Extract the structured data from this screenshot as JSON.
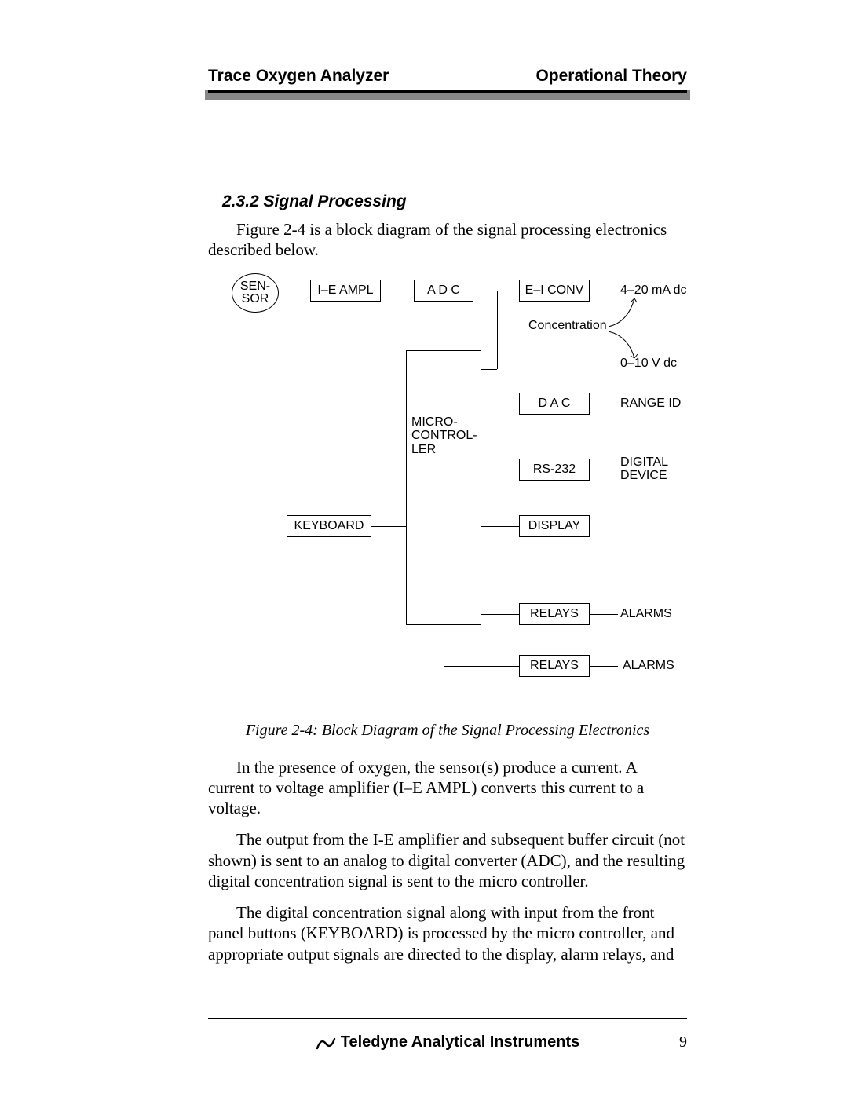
{
  "header": {
    "left": "Trace Oxygen Analyzer",
    "right": "Operational Theory"
  },
  "sectionHeading": "2.3.2 Signal Processing",
  "intro": "Figure 2-4 is a block diagram of the signal processing electronics described below.",
  "diagram": {
    "sensor": "SEN-\nSOR",
    "ieampl": "I–E AMPL",
    "adc": "A D C",
    "eiconv": "E–I CONV",
    "micro": "MICRO-\nCONTROL-\nLER",
    "keyboard": "KEYBOARD",
    "dac": "D A C",
    "rs232": "RS-232",
    "display": "DISPLAY",
    "relays1": "RELAYS",
    "relays2": "RELAYS",
    "out420": "4–20 mA dc",
    "concentration": "Concentration",
    "out010": "0–10 V dc",
    "rangeid": "RANGE ID",
    "digitaldevice": "DIGITAL\nDEVICE",
    "alarms1": "ALARMS",
    "alarms2": "ALARMS"
  },
  "caption": "Figure 2-4:  Block Diagram of the Signal Processing Electronics",
  "para1": "In the presence of oxygen, the sensor(s) produce a current. A current to voltage amplifier (I–E AMPL) converts this current to a voltage.",
  "para2": "The output from the I-E amplifier and subsequent buffer circuit (not shown) is sent to an analog to digital converter (ADC), and the resulting digital concentration signal is sent to the micro controller.",
  "para3": "The digital concentration signal along with input from the front panel buttons (KEYBOARD) is processed by the micro controller, and appropriate output signals are directed to the display, alarm relays, and",
  "footer": {
    "brand": "Teledyne Analytical Instruments",
    "page": "9"
  }
}
